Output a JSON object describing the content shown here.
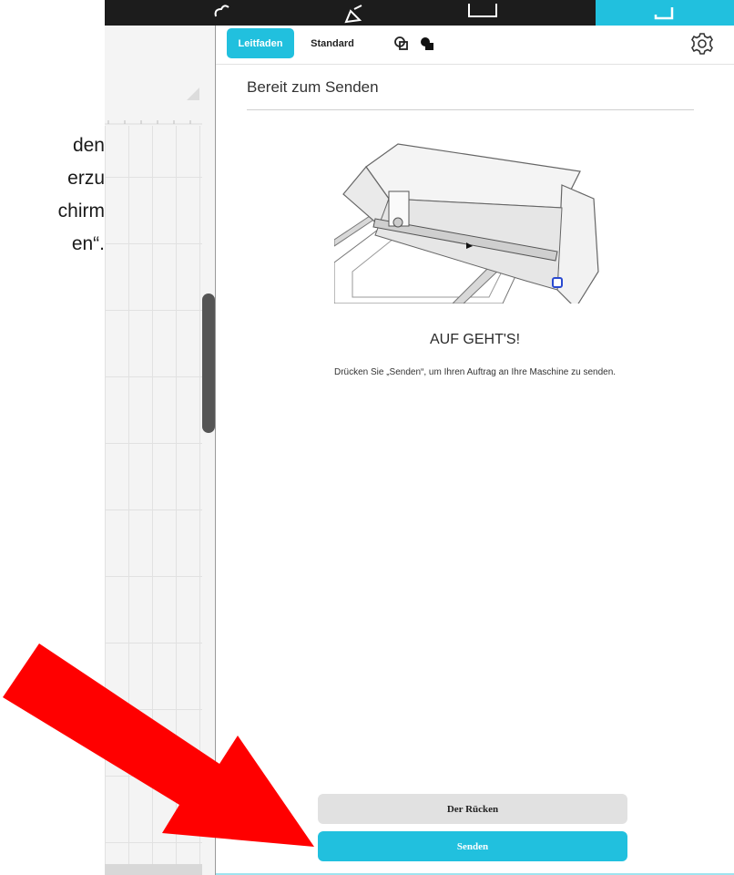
{
  "doc_text": {
    "lines": [
      "den",
      "erzu",
      "chirm",
      "en“."
    ]
  },
  "topbar": {
    "icons": [
      "cloud-icon",
      "pen-icon",
      "document-icon",
      "send-icon"
    ]
  },
  "panel": {
    "tabs": {
      "guided": "Leitfaden",
      "standard": "Standard"
    },
    "title": "Bereit zum Senden",
    "headline": "AUF GEHT'S!",
    "description": "Drücken Sie „Senden“, um Ihren Auftrag an Ihre Maschine zu senden.",
    "back_label": "Der Rücken",
    "send_label": "Senden"
  },
  "colors": {
    "accent": "#21c0de",
    "arrow": "#ff0000",
    "topbar": "#1c1c1c"
  }
}
